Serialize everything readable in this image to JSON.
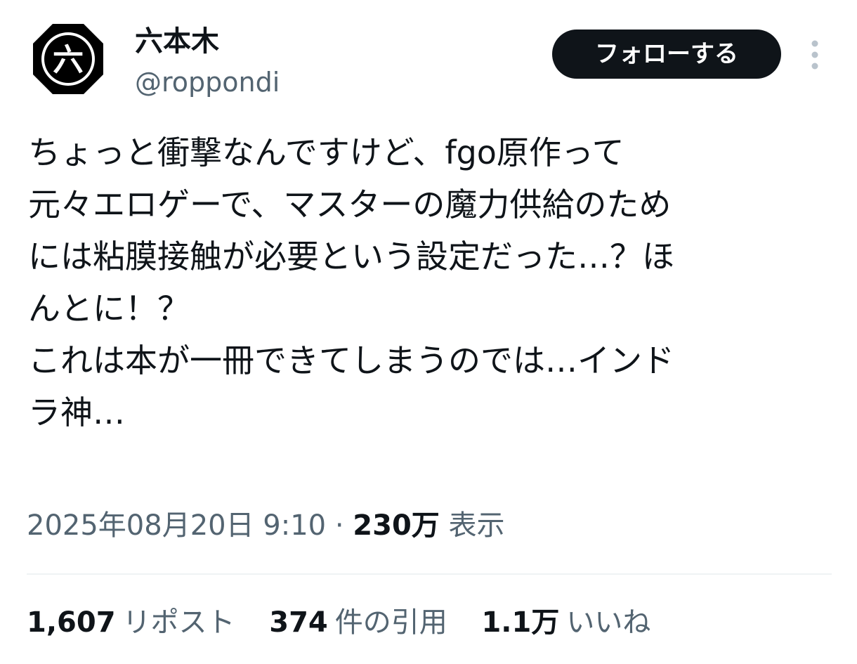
{
  "author": {
    "avatar_glyph": "六",
    "display_name": "六本木",
    "handle": "@roppondi"
  },
  "actions": {
    "follow_label": "フォローする",
    "more_icon": "vertical-dots-icon"
  },
  "tweet": {
    "lines": [
      "ちょっと衝撃なんですけど、fgo原作って",
      "元々エロゲーで、マスターの魔力供給のため",
      "には粘膜接触が必要という設定だった…？ほ",
      "んとに！？",
      "これは本が一冊できてしまうのでは…インド",
      "ラ神…"
    ]
  },
  "meta": {
    "timestamp": "2025年08月20日 9:10",
    "separator": "·",
    "views_count": "230万",
    "views_label": "表示"
  },
  "stats": {
    "reposts_count": "1,607",
    "reposts_label": "リポスト",
    "quotes_count": "374",
    "quotes_label": "件の引用",
    "likes_count": "1.1万",
    "likes_label": "いいね"
  },
  "colors": {
    "text_primary": "#0f1419",
    "text_secondary": "#536471",
    "button_bg": "#0f1419",
    "button_text": "#ffffff",
    "divider": "#eff3f4",
    "more_icon": "#b9c3cc"
  }
}
